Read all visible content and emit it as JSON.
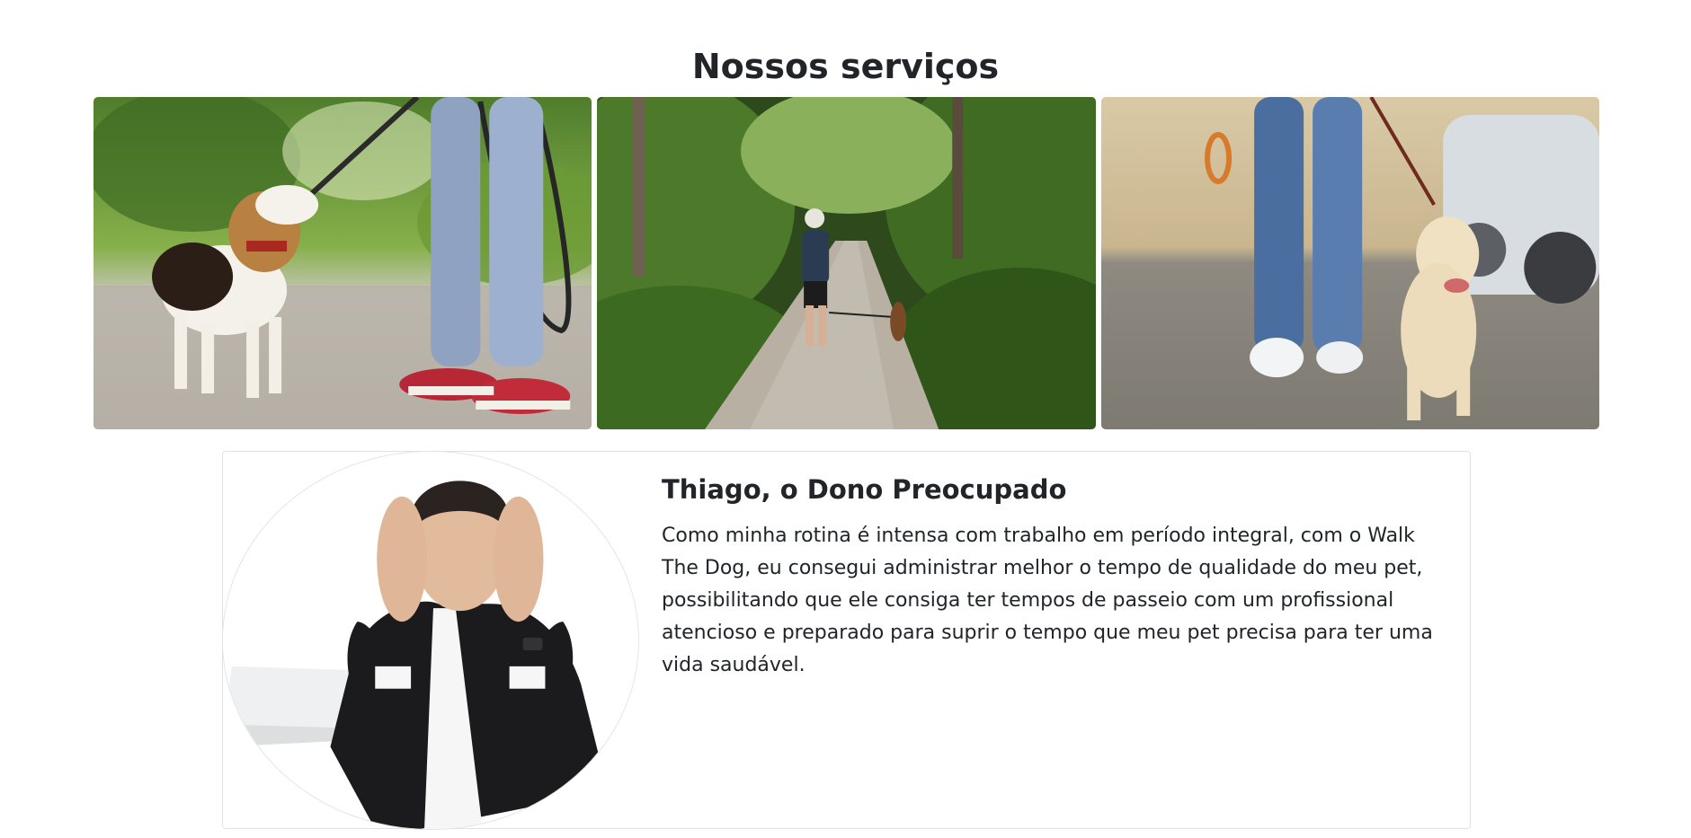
{
  "services": {
    "title": "Nossos serviços",
    "photos": [
      {
        "description": "beagle-walk-photo"
      },
      {
        "description": "forest-trail-walk-photo"
      },
      {
        "description": "labrador-street-walk-photo"
      }
    ]
  },
  "testimonial": {
    "name": "Thiago, o Dono Preocupado",
    "text": "Como minha rotina é intensa com trabalho em período integral, com o Walk The Dog, eu consegui administrar melhor o tempo de qualidade do meu pet, possibilitando que ele consiga ter tempos de passeio com um profissional atencioso e preparado para suprir o tempo que meu pet precisa para ter uma vida saudável."
  },
  "colors": {
    "text": "#212529",
    "card_border": "#dfe1e4"
  }
}
